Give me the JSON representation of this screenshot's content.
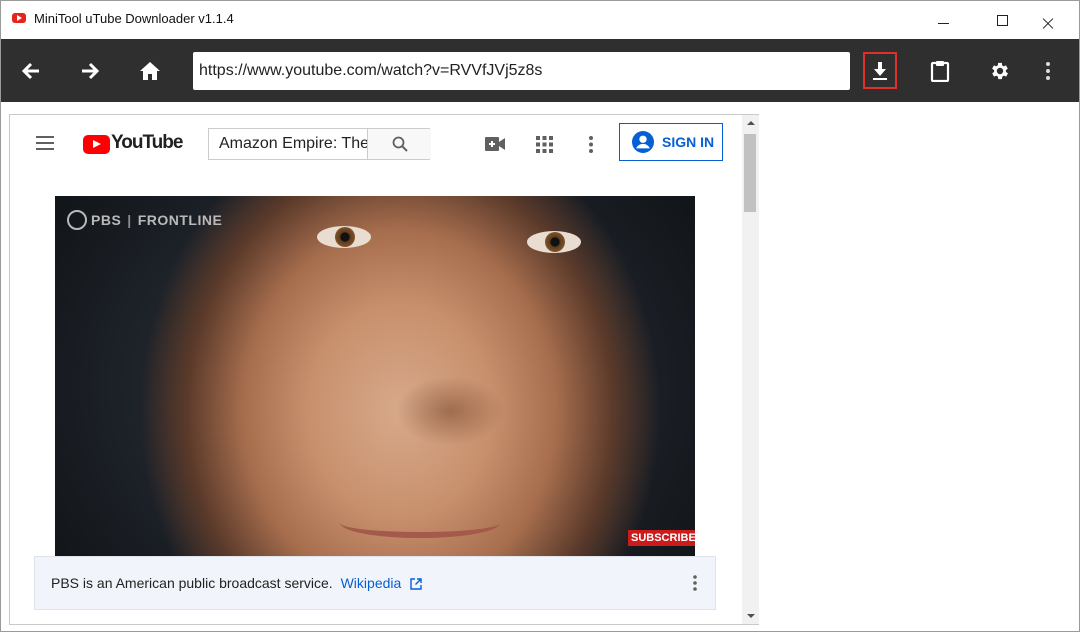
{
  "window": {
    "title": "MiniTool uTube Downloader v1.1.4"
  },
  "toolbar": {
    "url": "https://www.youtube.com/watch?v=RVVfJVj5z8s"
  },
  "youtube": {
    "logo_text": "YouTube",
    "search_value": "Amazon Empire: The",
    "sign_in_label": "SIGN IN"
  },
  "video": {
    "brand": "PBS",
    "program": "FRONTLINE",
    "subscribe_label": "SUBSCRIBE"
  },
  "info_panel": {
    "text": "PBS is an American public broadcast service.",
    "link_text": "Wikipedia"
  },
  "colors": {
    "toolbar_bg": "#2f2f2f",
    "download_highlight": "#e0302b",
    "youtube_red": "#ff0000",
    "link_blue": "#065fd4"
  }
}
